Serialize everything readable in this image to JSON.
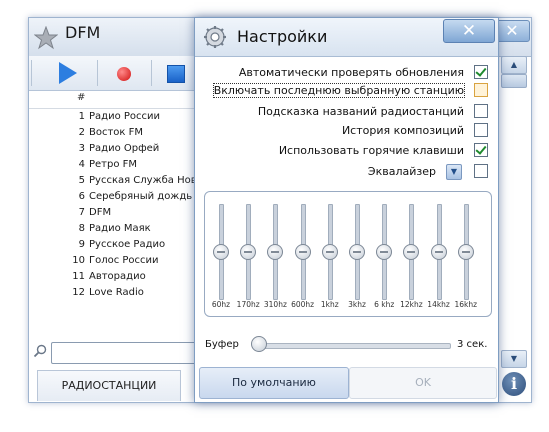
{
  "main": {
    "title": "DFM",
    "close_glyph": "✕",
    "list_header": "#",
    "stations": [
      {
        "num": "1",
        "name": "Радио России"
      },
      {
        "num": "2",
        "name": "Восток FM"
      },
      {
        "num": "3",
        "name": "Радио Орфей"
      },
      {
        "num": "4",
        "name": "Ретро FM"
      },
      {
        "num": "5",
        "name": "Русская Служба Нов"
      },
      {
        "num": "6",
        "name": "Серебряный дождь"
      },
      {
        "num": "7",
        "name": "DFM"
      },
      {
        "num": "8",
        "name": "Радио Маяк"
      },
      {
        "num": "9",
        "name": "Русское Радио"
      },
      {
        "num": "10",
        "name": "Голос России"
      },
      {
        "num": "11",
        "name": "Авторадио"
      },
      {
        "num": "12",
        "name": "Love Radio"
      }
    ],
    "tab_label": "РАДИОСТАНЦИИ",
    "icons": [
      "star-icon",
      "play-icon",
      "record-icon",
      "stop-icon",
      "search-icon",
      "info-icon"
    ]
  },
  "dialog": {
    "title": "Настройки",
    "close_glyph": "✕",
    "options": [
      {
        "label": "Автоматически проверять обновления",
        "checked": true
      },
      {
        "label": "Включать последнюю выбранную станцию",
        "checked": false,
        "focused": true
      },
      {
        "label": "Подсказка названий радиостанций",
        "checked": false
      },
      {
        "label": "История композиций",
        "checked": false
      },
      {
        "label": "Использовать горячие клавиши",
        "checked": true
      },
      {
        "label": "Эквалайзер",
        "checked": false
      }
    ],
    "equalizer": {
      "bands": [
        "60hz",
        "170hz",
        "310hz",
        "600hz",
        "1khz",
        "3khz",
        "6 khz",
        "12khz",
        "14khz",
        "16khz"
      ],
      "levels_percent": [
        50,
        50,
        50,
        50,
        50,
        50,
        50,
        50,
        50,
        50
      ]
    },
    "buffer": {
      "label": "Буфер",
      "value": "3 сек.",
      "level_percent": 0
    },
    "buttons": {
      "default": "По умолчанию",
      "ok": "OK"
    },
    "accent_color": "#2d7ee0",
    "check_color": "#1f8a2e"
  }
}
